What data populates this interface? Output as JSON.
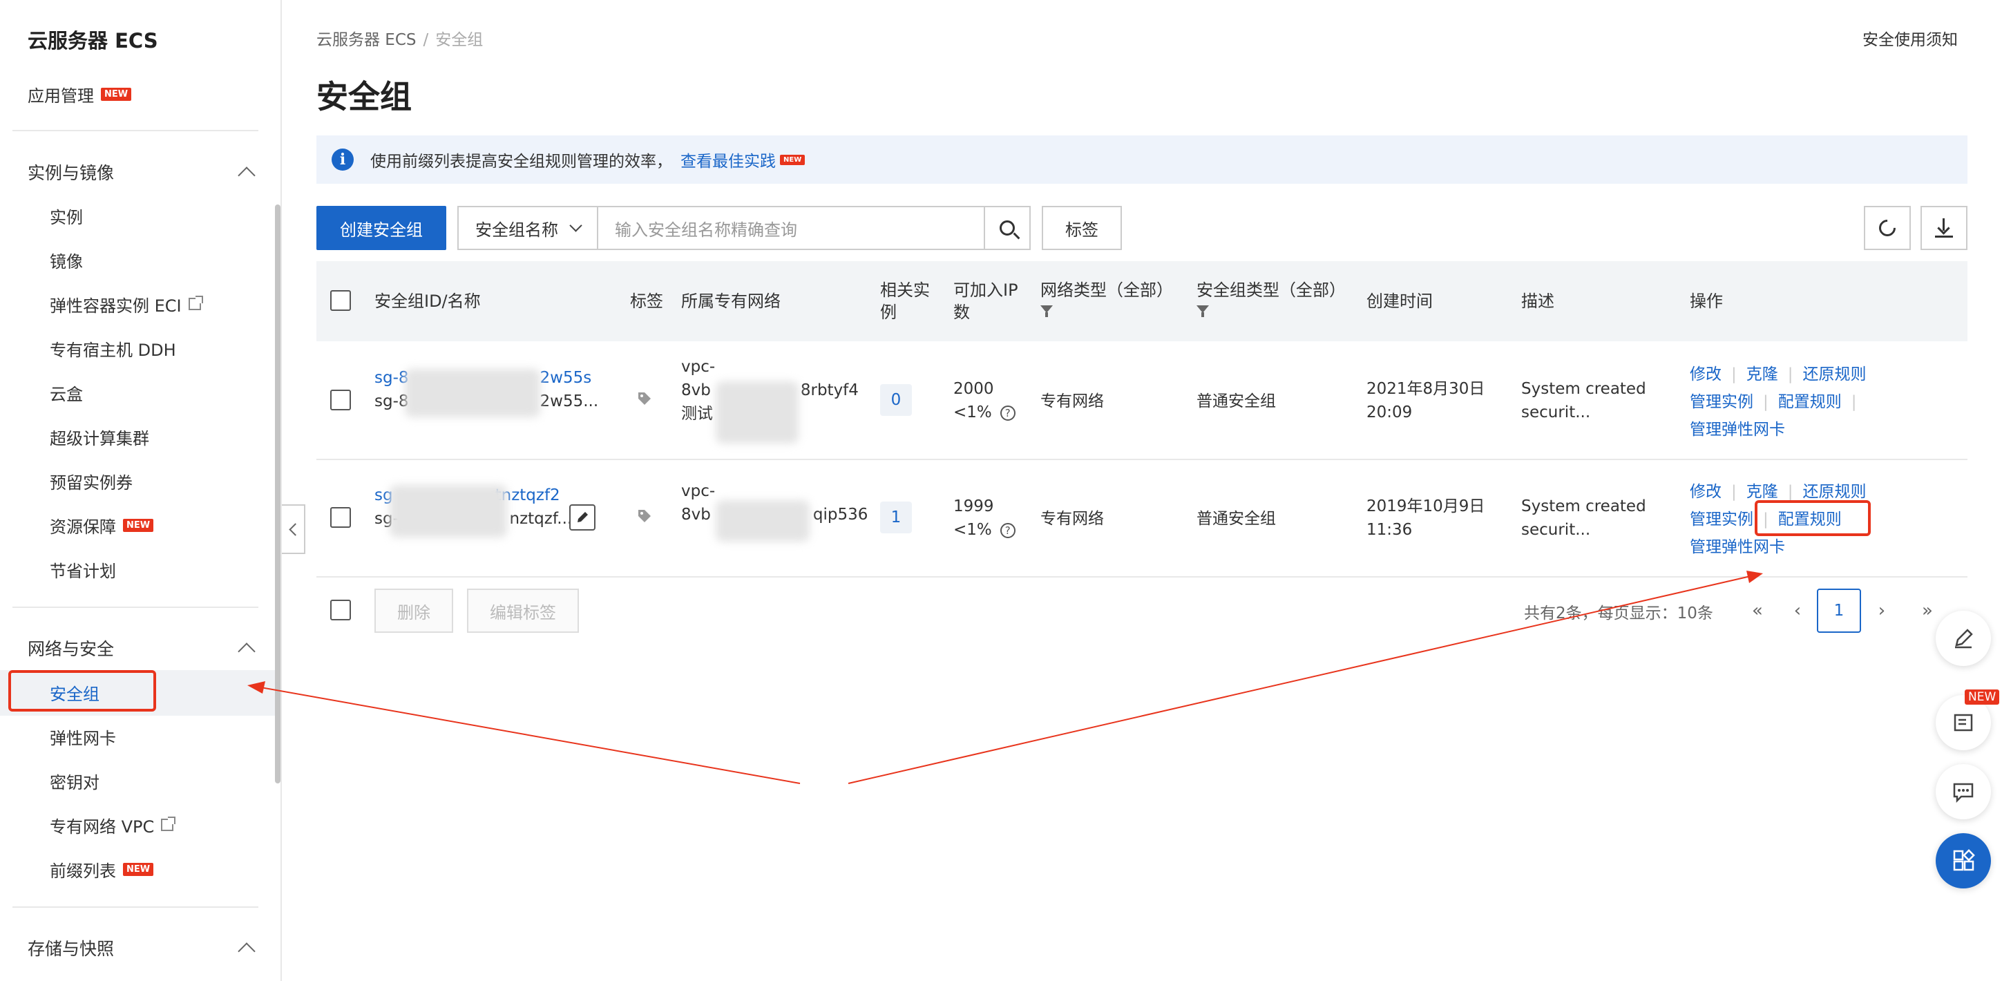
{
  "sidebar": {
    "title": "云服务器 ECS",
    "app_mgmt": "应用管理",
    "new_badge": "NEW",
    "group_instances": "实例与镜像",
    "items_instances": [
      "实例",
      "镜像",
      "弹性容器实例 ECI",
      "专有宿主机 DDH",
      "云盒",
      "超级计算集群",
      "预留实例券",
      "资源保障",
      "节省计划"
    ],
    "group_network": "网络与安全",
    "items_network": [
      "安全组",
      "弹性网卡",
      "密钥对",
      "专有网络 VPC",
      "前缀列表"
    ],
    "group_storage": "存储与快照"
  },
  "breadcrumb": {
    "root": "云服务器 ECS",
    "sep": "/",
    "current": "安全组"
  },
  "top_link": "安全使用须知",
  "page_title": "安全组",
  "notice": {
    "text": "使用前缀列表提高安全组规则管理的效率，",
    "link": "查看最佳实践",
    "badge": "NEW"
  },
  "toolbar": {
    "create": "创建安全组",
    "select": "安全组名称",
    "search_placeholder": "输入安全组名称精确查询",
    "tag": "标签"
  },
  "table": {
    "headers": {
      "id": "安全组ID/名称",
      "tag": "标签",
      "vpc": "所属专有网络",
      "related_1": "相关实",
      "related_2": "例",
      "ip_1": "可加入IP",
      "ip_2": "数",
      "nettype": "网络类型（全部）",
      "sgtype": "安全组类型（全部）",
      "created": "创建时间",
      "desc": "描述",
      "ops": "操作"
    },
    "rows": [
      {
        "id": "sg-8",
        "id_suffix": "2w55s",
        "name": "sg-8",
        "name_suffix": "2w55...",
        "vpc_1": "vpc-",
        "vpc_2": "8vb",
        "vpc_2_suffix": "8rbtyf4",
        "vpc_3": "测试",
        "related": "0",
        "ip_count": "2000",
        "ip_pct": "<1%",
        "nettype": "专有网络",
        "sgtype": "普通安全组",
        "created_1": "2021年8月30日",
        "created_2": "20:09",
        "desc_1": "System created",
        "desc_2": "securit...",
        "ops": [
          "修改",
          "克隆",
          "还原规则",
          "管理实例",
          "配置规则",
          "管理弹性网卡"
        ]
      },
      {
        "id": "sg",
        "id_suffix": "tnztqzf2",
        "name": "sg-8",
        "name_suffix": "nztqzf...",
        "vpc_1": "vpc-",
        "vpc_2": "8vb",
        "vpc_2_suffix": "qip536",
        "related": "1",
        "ip_count": "1999",
        "ip_pct": "<1%",
        "nettype": "专有网络",
        "sgtype": "普通安全组",
        "created_1": "2019年10月9日",
        "created_2": "11:36",
        "desc_1": "System created",
        "desc_2": "securit...",
        "ops": [
          "修改",
          "克隆",
          "还原规则",
          "管理实例",
          "配置规则",
          "管理弹性网卡"
        ]
      }
    ]
  },
  "footer": {
    "delete": "删除",
    "edit_tags": "编辑标签",
    "summary": "共有2条，每页显示：10条",
    "page": "1"
  },
  "float_new": "NEW",
  "colors": {
    "accent": "#1a66c8",
    "annotation": "#e8341c"
  }
}
